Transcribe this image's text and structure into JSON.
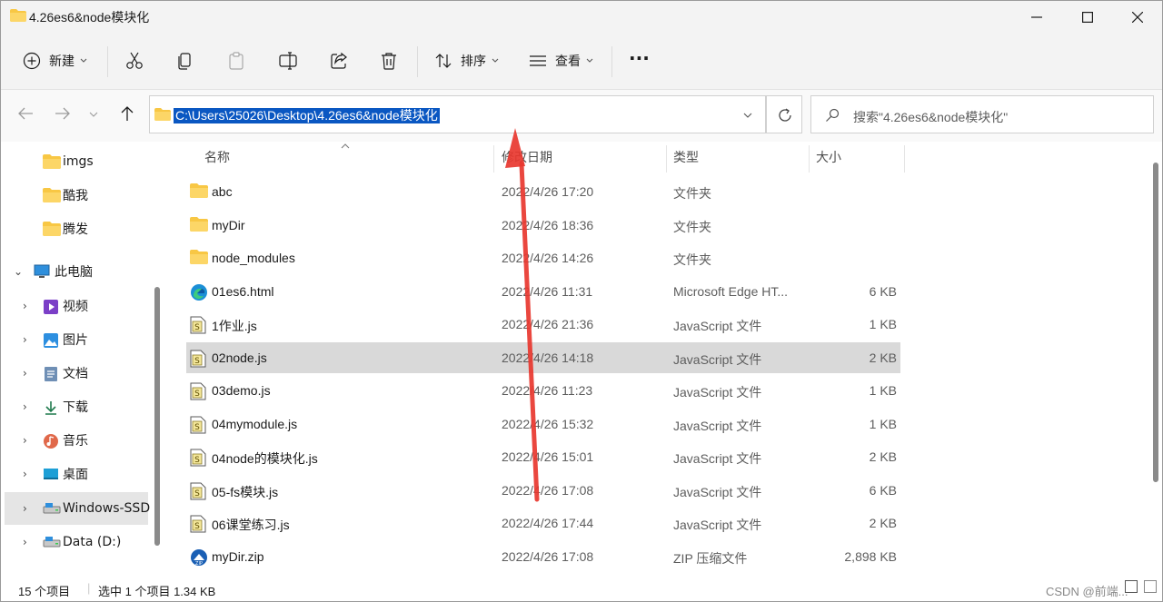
{
  "window": {
    "title": "4.26es6&node模块化"
  },
  "toolbar": {
    "new": "新建",
    "sort": "排序",
    "view": "查看",
    "more": "···"
  },
  "address": {
    "path": "C:\\Users\\25026\\Desktop\\4.26es6&node模块化"
  },
  "search": {
    "placeholder": "搜索\"4.26es6&node模块化\""
  },
  "sidebar": {
    "items": [
      {
        "label": "imgs",
        "icon": "folder-icon"
      },
      {
        "label": "酷我",
        "icon": "folder-icon"
      },
      {
        "label": "腾发",
        "icon": "folder-icon"
      },
      {
        "label": "此电脑",
        "icon": "pc-icon"
      },
      {
        "label": "视频",
        "icon": "video-icon"
      },
      {
        "label": "图片",
        "icon": "picture-icon"
      },
      {
        "label": "文档",
        "icon": "document-icon"
      },
      {
        "label": "下载",
        "icon": "download-icon"
      },
      {
        "label": "音乐",
        "icon": "music-icon"
      },
      {
        "label": "桌面",
        "icon": "desktop-icon"
      },
      {
        "label": "Windows-SSD",
        "icon": "drive-icon"
      },
      {
        "label": "Data (D:)",
        "icon": "drive-icon"
      }
    ]
  },
  "columns": {
    "name": "名称",
    "date": "修改日期",
    "type": "类型",
    "size": "大小"
  },
  "files": [
    {
      "name": "abc",
      "date": "2022/4/26 17:20",
      "type": "文件夹",
      "size": "",
      "icon": "folder-icon"
    },
    {
      "name": "myDir",
      "date": "2022/4/26 18:36",
      "type": "文件夹",
      "size": "",
      "icon": "folder-icon"
    },
    {
      "name": "node_modules",
      "date": "2022/4/26 14:26",
      "type": "文件夹",
      "size": "",
      "icon": "folder-icon"
    },
    {
      "name": "01es6.html",
      "date": "2022/4/26 11:31",
      "type": "Microsoft Edge HT...",
      "size": "6 KB",
      "icon": "edge-icon"
    },
    {
      "name": "1作业.js",
      "date": "2022/4/26 21:36",
      "type": "JavaScript 文件",
      "size": "1 KB",
      "icon": "js-file-icon"
    },
    {
      "name": "02node.js",
      "date": "2022/4/26 14:18",
      "type": "JavaScript 文件",
      "size": "2 KB",
      "icon": "js-file-icon"
    },
    {
      "name": "03demo.js",
      "date": "2022/4/26 11:23",
      "type": "JavaScript 文件",
      "size": "1 KB",
      "icon": "js-file-icon"
    },
    {
      "name": "04mymodule.js",
      "date": "2022/4/26 15:32",
      "type": "JavaScript 文件",
      "size": "1 KB",
      "icon": "js-file-icon"
    },
    {
      "name": "04node的模块化.js",
      "date": "2022/4/26 15:01",
      "type": "JavaScript 文件",
      "size": "2 KB",
      "icon": "js-file-icon"
    },
    {
      "name": "05-fs模块.js",
      "date": "2022/4/26 17:08",
      "type": "JavaScript 文件",
      "size": "6 KB",
      "icon": "js-file-icon"
    },
    {
      "name": "06课堂练习.js",
      "date": "2022/4/26 17:44",
      "type": "JavaScript 文件",
      "size": "2 KB",
      "icon": "js-file-icon"
    },
    {
      "name": "myDir.zip",
      "date": "2022/4/26 17:08",
      "type": "ZIP 压缩文件",
      "size": "2,898 KB",
      "icon": "zip-icon"
    }
  ],
  "status": {
    "count": "15 个项目",
    "selection": "选中 1 个项目  1.34 KB"
  },
  "watermark": "CSDN @前端..."
}
